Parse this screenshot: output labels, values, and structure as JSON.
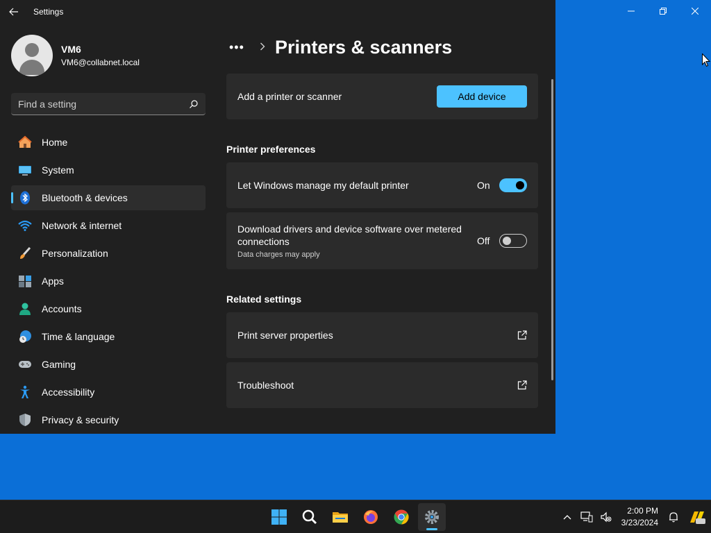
{
  "window": {
    "title": "Settings"
  },
  "profile": {
    "name": "VM6",
    "email": "VM6@collabnet.local"
  },
  "search": {
    "placeholder": "Find a setting"
  },
  "sidebar": {
    "items": [
      {
        "label": "Home",
        "icon": "home-icon"
      },
      {
        "label": "System",
        "icon": "system-icon"
      },
      {
        "label": "Bluetooth & devices",
        "icon": "bluetooth-icon",
        "active": true
      },
      {
        "label": "Network & internet",
        "icon": "wifi-icon"
      },
      {
        "label": "Personalization",
        "icon": "brush-icon"
      },
      {
        "label": "Apps",
        "icon": "apps-icon"
      },
      {
        "label": "Accounts",
        "icon": "accounts-icon"
      },
      {
        "label": "Time & language",
        "icon": "globe-clock-icon"
      },
      {
        "label": "Gaming",
        "icon": "gamepad-icon"
      },
      {
        "label": "Accessibility",
        "icon": "accessibility-icon"
      },
      {
        "label": "Privacy & security",
        "icon": "shield-icon"
      }
    ]
  },
  "breadcrumb": {
    "more": "•••",
    "title": "Printers & scanners"
  },
  "main": {
    "add_label": "Add a printer or scanner",
    "add_button": "Add device",
    "prefs_title": "Printer preferences",
    "default_printer": {
      "label": "Let Windows manage my default printer",
      "state": "On"
    },
    "metered": {
      "label": "Download drivers and device software over metered connections",
      "sub": "Data charges may apply",
      "state": "Off"
    },
    "related_title": "Related settings",
    "print_server": "Print server properties",
    "troubleshoot": "Troubleshoot"
  },
  "taskbar": {
    "time": "2:00 PM",
    "date": "3/23/2024"
  },
  "colors": {
    "accent": "#4cc2ff",
    "window_bg": "#202020",
    "card_bg": "#2b2b2b",
    "desktop": "#0b6fd7"
  }
}
